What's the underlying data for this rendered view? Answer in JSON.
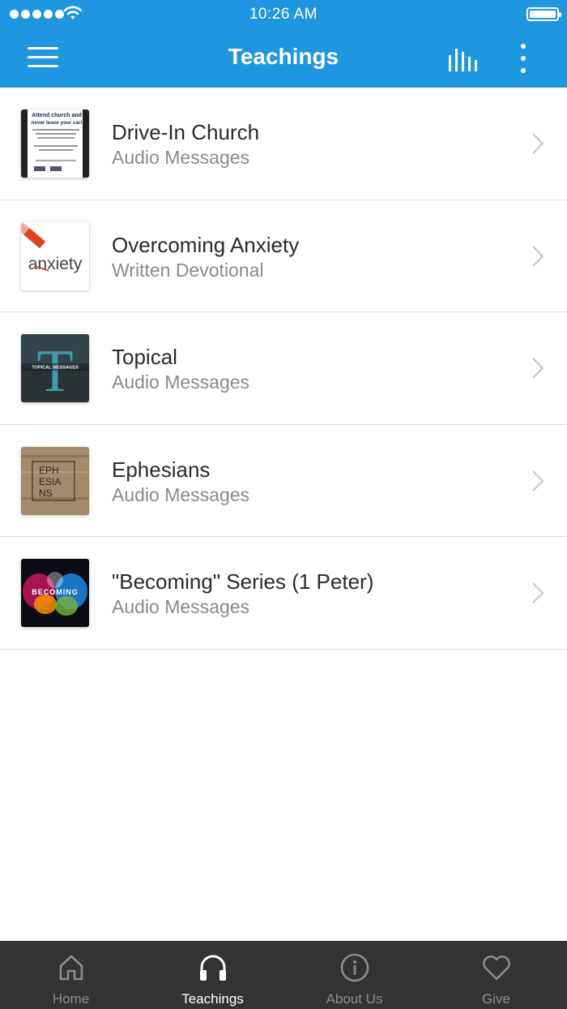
{
  "status_bar": {
    "time": "10:26 AM"
  },
  "header": {
    "title": "Teachings"
  },
  "items": [
    {
      "title": "Drive-In Church",
      "subtitle": "Audio Messages",
      "thumb_text": [
        "Attend church and",
        "never leave your car!"
      ]
    },
    {
      "title": "Overcoming Anxiety",
      "subtitle": "Written Devotional",
      "thumb_text": [
        "anxiety"
      ]
    },
    {
      "title": "Topical",
      "subtitle": "Audio Messages",
      "thumb_text": [
        "T",
        "TOPICAL MESSAGES"
      ]
    },
    {
      "title": "Ephesians",
      "subtitle": "Audio Messages",
      "thumb_text": [
        "EPH",
        "ESIA",
        "NS"
      ]
    },
    {
      "title": "\"Becoming\" Series (1 Peter)",
      "subtitle": "Audio Messages",
      "thumb_text": [
        "BECOMING"
      ]
    }
  ],
  "tabs": [
    {
      "label": "Home",
      "icon": "home-icon"
    },
    {
      "label": "Teachings",
      "icon": "headphones-icon"
    },
    {
      "label": "About Us",
      "icon": "info-icon"
    },
    {
      "label": "Give",
      "icon": "heart-icon"
    }
  ],
  "colors": {
    "accent": "#1e97e0",
    "tabbar": "#333333",
    "active_tab": "#ffffff",
    "inactive_tab": "#8c8c8c"
  }
}
